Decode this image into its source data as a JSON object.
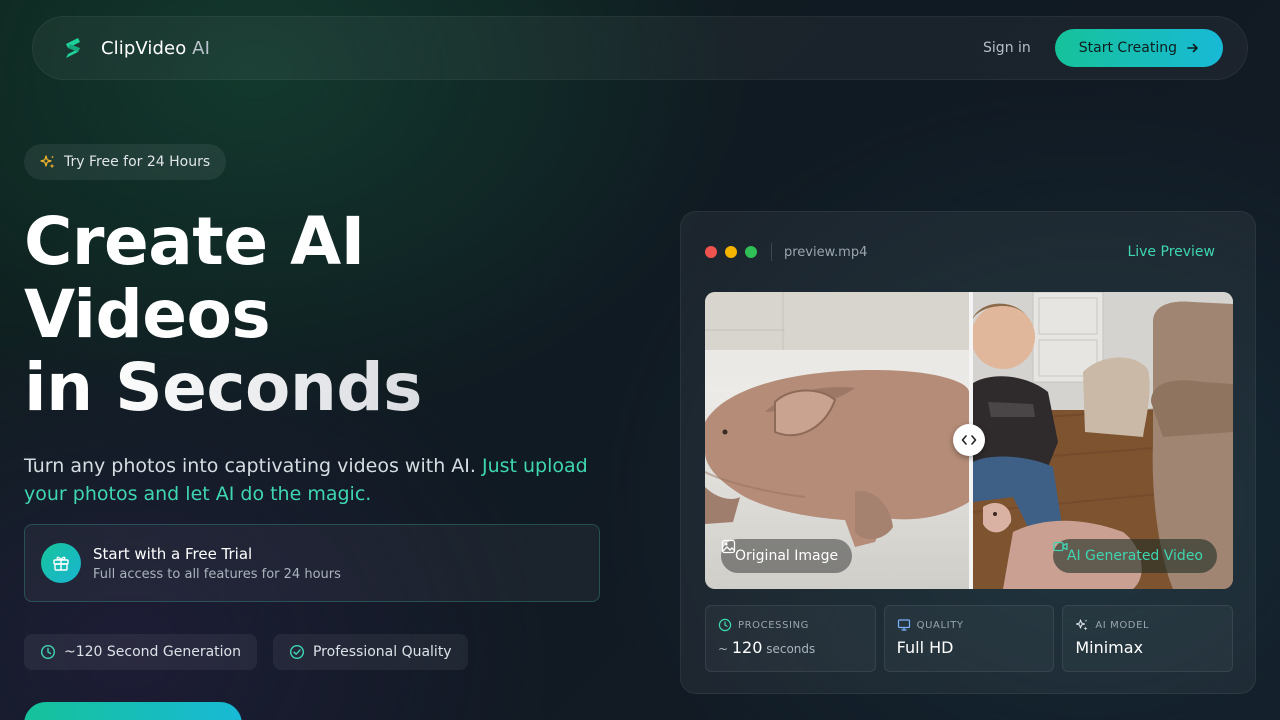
{
  "nav": {
    "brand_main": "ClipVideo",
    "brand_suffix": " AI",
    "signin_label": "Sign in",
    "start_label": "Start Creating"
  },
  "hero": {
    "badge_label": "Try Free for 24 Hours",
    "title_line1": "Create AI",
    "title_line2": "Videos",
    "title_line3": "in Seconds",
    "subtitle_plain": "Turn any photos into captivating videos with AI. ",
    "subtitle_highlight": "Just upload your photos and let AI do the magic.",
    "trial_title": "Start with a Free Trial",
    "trial_subtitle": "Full access to all features for 24 hours",
    "chips": [
      {
        "label": "~120 Second Generation",
        "icon": "clock-icon"
      },
      {
        "label": "Professional Quality",
        "icon": "check-circle-icon"
      }
    ]
  },
  "preview": {
    "filename": "preview.mp4",
    "live_label": "Live Preview",
    "original_tag": "Original Image",
    "ai_tag": "AI Generated Video",
    "stats": [
      {
        "label": "PROCESSING",
        "prefix": "~ ",
        "value": "120",
        "unit": " seconds",
        "icon": "clock-icon"
      },
      {
        "label": "QUALITY",
        "value": "Full HD",
        "icon": "monitor-icon"
      },
      {
        "label": "AI MODEL",
        "value": "Minimax",
        "icon": "sparkles-icon"
      }
    ]
  },
  "colors": {
    "accent": "#3fd6b1",
    "button_gradient_start": "#16c29a",
    "button_gradient_end": "#18b9d6"
  }
}
